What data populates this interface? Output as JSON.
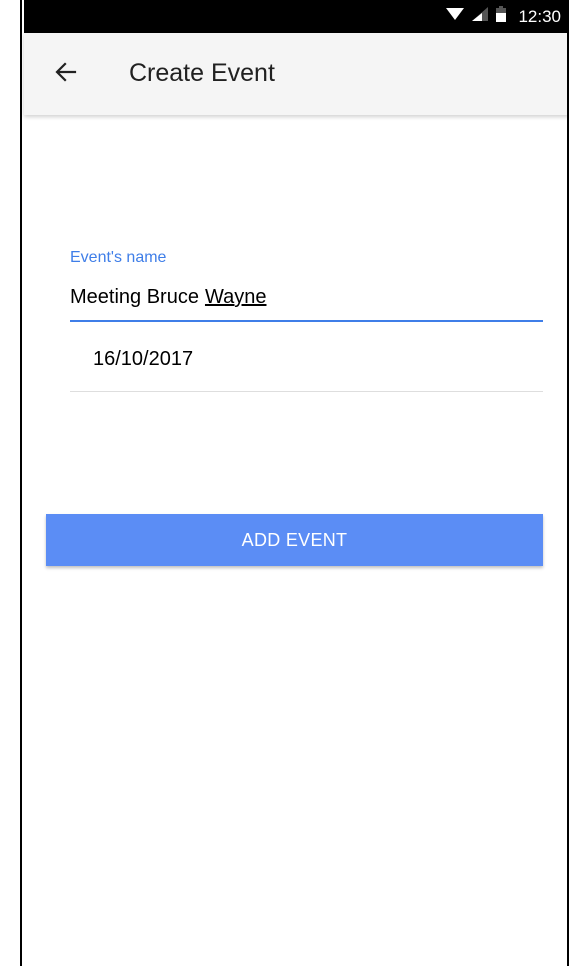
{
  "status_bar": {
    "time": "12:30",
    "icons": [
      "wifi-icon",
      "signal-icon",
      "battery-icon"
    ]
  },
  "app_bar": {
    "title": "Create Event",
    "back_icon": "arrow-back-icon"
  },
  "form": {
    "name_label": "Event's name",
    "name_value_part1": "Meeting Bruce",
    "name_value_part2": "Wayne",
    "date_value": "16/10/2017"
  },
  "actions": {
    "add_label": "ADD EVENT"
  },
  "colors": {
    "accent": "#3f7ee8",
    "button": "#5b8df5",
    "app_bar_bg": "#f5f5f5",
    "status_bar_bg": "#000000"
  }
}
